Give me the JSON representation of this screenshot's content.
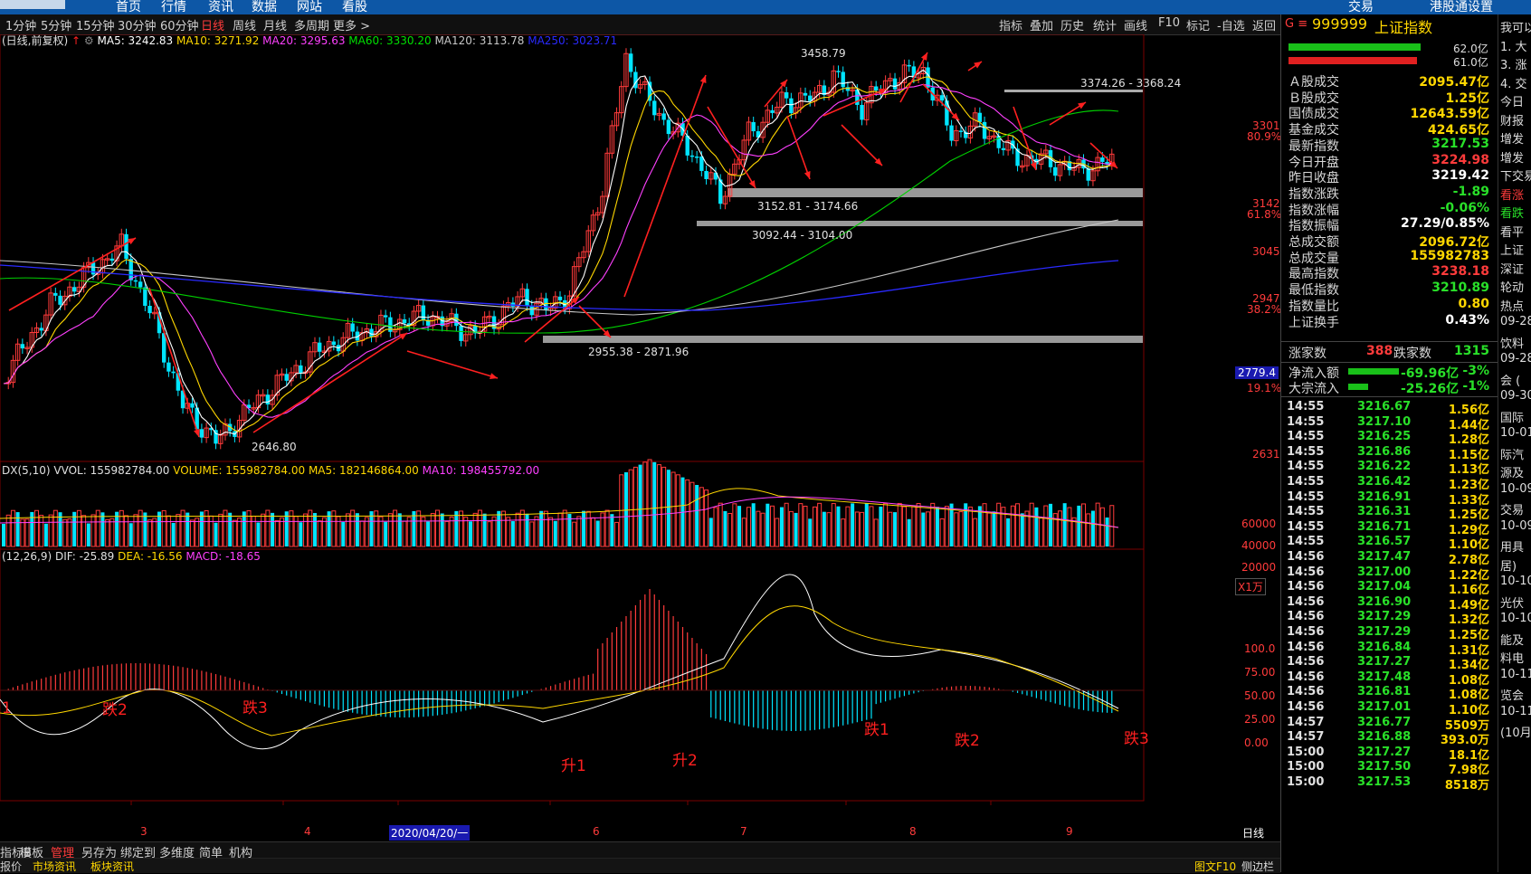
{
  "top_nav": [
    "首页",
    "行情",
    "资讯",
    "数据",
    "网站",
    "看股"
  ],
  "top_right": [
    "交易",
    "港股通设置"
  ],
  "periods": [
    "1分钟",
    "5分钟",
    "15分钟",
    "30分钟",
    "60分钟",
    "日线",
    "周线",
    "月线",
    "多周期",
    "更多 >"
  ],
  "active_period": "日线",
  "tools": [
    "指标",
    "叠加",
    "历史",
    "统计",
    "画线",
    "F10",
    "标记",
    "-自选",
    "返回"
  ],
  "ma_legend": {
    "prefix": "(日线,前复权)",
    "items": [
      {
        "label": "MA5: 3242.83",
        "color": "#ffffff"
      },
      {
        "label": "MA10: 3271.92",
        "color": "#ffd700"
      },
      {
        "label": "MA20: 3295.63",
        "color": "#ff40ff"
      },
      {
        "label": "MA60: 3330.20",
        "color": "#00e000"
      },
      {
        "label": "MA120: 3113.78",
        "color": "#c8c8c8"
      },
      {
        "label": "MA250: 3023.71",
        "color": "#2a2aff"
      }
    ]
  },
  "price_axis": [
    {
      "v": "3301",
      "pct": "80.9%"
    },
    {
      "v": "3142",
      "pct": "61.8%"
    },
    {
      "v": "3045",
      "pct": ""
    },
    {
      "v": "2947",
      "pct": "38.2%"
    },
    {
      "v": "2779.4",
      "pct": "",
      "boxed": true
    },
    {
      "v": "",
      "pct": "19.1%"
    },
    {
      "v": "2631",
      "pct": ""
    }
  ],
  "annotations": {
    "high": "3458.79",
    "low": "2646.80",
    "zone1": "3374.26 - 3368.24",
    "zone2": "3152.81 - 3174.66",
    "zone3": "3092.44 - 3104.00",
    "zone4": "2955.38 - 2871.96"
  },
  "vol_legend": {
    "prefix": "DX(5,10)",
    "items": [
      {
        "label": "VVOL: 155982784.00",
        "color": "#e0e0e0"
      },
      {
        "label": "VOLUME: 155982784.00",
        "color": "#ffd700"
      },
      {
        "label": "MA5: 182146864.00",
        "color": "#ffd700"
      },
      {
        "label": "MA10: 198455792.00",
        "color": "#ff40ff"
      }
    ],
    "axis": [
      "60000",
      "40000",
      "20000",
      "X1万"
    ]
  },
  "macd_legend": {
    "prefix": "(12,26,9)",
    "items": [
      {
        "label": "DIF: -25.89",
        "color": "#e0e0e0"
      },
      {
        "label": "DEA: -16.56",
        "color": "#ffd700"
      },
      {
        "label": "MACD: -18.65",
        "color": "#ff40ff"
      }
    ],
    "axis": [
      "100.0",
      "75.00",
      "50.00",
      "25.00",
      "0.00"
    ]
  },
  "macd_marks": [
    "1",
    "跌2",
    "跌3",
    "升1",
    "升2",
    "跌1",
    "跌2",
    "跌3"
  ],
  "x_axis": [
    "3",
    "4",
    "2020/04/20/一",
    "6",
    "7",
    "8",
    "9"
  ],
  "x_right_label": "日线",
  "bottom_tabs": [
    "指标B",
    "模板",
    "管理",
    "另存为",
    "绑定到",
    "多维度",
    "简单",
    "机构"
  ],
  "active_bottom_tab": "管理",
  "status_tabs": [
    "报价",
    "市场资讯",
    "板块资讯"
  ],
  "status_right": [
    "图文F10",
    "侧边栏"
  ],
  "panel": {
    "code": "999999",
    "name": "上证指数",
    "bar1": "62.0亿",
    "bar2": "61.0亿",
    "rows": [
      {
        "k": "Ａ股成交",
        "v": "2095.47亿",
        "c": "#ffd700"
      },
      {
        "k": "Ｂ股成交",
        "v": "1.25亿",
        "c": "#ffd700"
      },
      {
        "k": "国债成交",
        "v": "12643.59亿",
        "c": "#ffd700"
      },
      {
        "k": "基金成交",
        "v": "424.65亿",
        "c": "#ffd700"
      },
      {
        "k": "最新指数",
        "v": "3217.53",
        "c": "#29e029"
      },
      {
        "k": "今日开盘",
        "v": "3224.98",
        "c": "#ff3b3b"
      },
      {
        "k": "昨日收盘",
        "v": "3219.42",
        "c": "#ffffff"
      },
      {
        "k": "指数涨跌",
        "v": "-1.89",
        "c": "#29e029"
      },
      {
        "k": "指数涨幅",
        "v": "-0.06%",
        "c": "#29e029"
      },
      {
        "k": "指数振幅",
        "v": "27.29/0.85%",
        "c": "#ffffff"
      },
      {
        "k": "总成交额",
        "v": "2096.72亿",
        "c": "#ffd700"
      },
      {
        "k": "总成交量",
        "v": "155982783",
        "c": "#ffd700"
      },
      {
        "k": "最高指数",
        "v": "3238.18",
        "c": "#ff3b3b"
      },
      {
        "k": "最低指数",
        "v": "3210.89",
        "c": "#29e029"
      },
      {
        "k": "指数量比",
        "v": "0.80",
        "c": "#ffd700"
      },
      {
        "k": "上证换手",
        "v": "0.43%",
        "c": "#ffffff"
      }
    ],
    "up_label": "涨家数",
    "up": "388",
    "down_label": "跌家数",
    "down": "1315",
    "flow": [
      {
        "k": "净流入额",
        "v": "-69.96亿",
        "pct": "-3%"
      },
      {
        "k": "大宗流入",
        "v": "-25.26亿",
        "pct": "-1%"
      }
    ],
    "ticks": [
      [
        "14:55",
        "3216.67",
        "1.56亿"
      ],
      [
        "14:55",
        "3217.10",
        "1.44亿"
      ],
      [
        "14:55",
        "3216.25",
        "1.28亿"
      ],
      [
        "14:55",
        "3216.86",
        "1.15亿"
      ],
      [
        "14:55",
        "3216.22",
        "1.13亿"
      ],
      [
        "14:55",
        "3216.42",
        "1.23亿"
      ],
      [
        "14:55",
        "3216.91",
        "1.33亿"
      ],
      [
        "14:55",
        "3216.31",
        "1.25亿"
      ],
      [
        "14:55",
        "3216.71",
        "1.29亿"
      ],
      [
        "14:55",
        "3216.57",
        "1.10亿"
      ],
      [
        "14:56",
        "3217.47",
        "2.78亿"
      ],
      [
        "14:56",
        "3217.00",
        "1.22亿"
      ],
      [
        "14:56",
        "3217.04",
        "1.16亿"
      ],
      [
        "14:56",
        "3216.90",
        "1.49亿"
      ],
      [
        "14:56",
        "3217.29",
        "1.32亿"
      ],
      [
        "14:56",
        "3217.29",
        "1.25亿"
      ],
      [
        "14:56",
        "3216.84",
        "1.31亿"
      ],
      [
        "14:56",
        "3217.27",
        "1.34亿"
      ],
      [
        "14:56",
        "3217.48",
        "1.08亿"
      ],
      [
        "14:56",
        "3216.81",
        "1.08亿"
      ],
      [
        "14:56",
        "3217.01",
        "1.10亿"
      ],
      [
        "14:57",
        "3216.77",
        "5509万"
      ],
      [
        "14:57",
        "3216.88",
        "393.0万"
      ],
      [
        "15:00",
        "3217.27",
        "18.1亿"
      ],
      [
        "15:00",
        "3217.50",
        "7.98亿"
      ],
      [
        "15:00",
        "3217.53",
        "8518万"
      ]
    ]
  },
  "far_right": [
    "我可以",
    "1. 大",
    "3. 涨",
    "4. 交",
    "今日",
    "财报",
    "增发",
    "增发",
    "下交易",
    "看涨",
    "看跌",
    "看平",
    "上证",
    "深证",
    "轮动",
    "热点",
    "09-28",
    "饮料",
    "09-28",
    "会 (",
    "09-30",
    "国际",
    "10-01",
    "际汽",
    "源及",
    "10-09",
    "交易",
    "10-09",
    "用具",
    "居)",
    "10-10",
    "光伏",
    "10-10",
    "能及",
    "料电",
    "10-11",
    "览会",
    "10-11",
    "(10月"
  ]
}
